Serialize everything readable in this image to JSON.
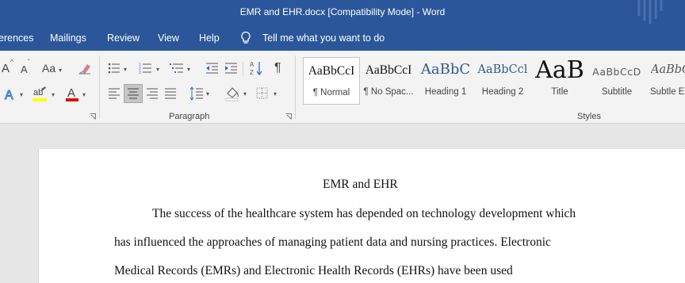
{
  "window": {
    "title": "EMR and EHR.docx [Compatibility Mode]  -  Word"
  },
  "menu": {
    "tabs": [
      "erences",
      "Mailings",
      "Review",
      "View",
      "Help"
    ],
    "tell_me": "Tell me what you want to do"
  },
  "ribbon": {
    "font_size_increase": "A",
    "font_size_decrease": "A",
    "change_case": "Aa",
    "paragraph_label": "Paragraph",
    "styles_label": "Styles",
    "styles": [
      {
        "sample": "AaBbCcI",
        "name": "¶ Normal"
      },
      {
        "sample": "AaBbCcI",
        "name": "¶ No Spac..."
      },
      {
        "sample": "AaBbC",
        "name": "Heading 1"
      },
      {
        "sample": "AaBbCcl",
        "name": "Heading 2"
      },
      {
        "sample": "AaB",
        "name": "Title"
      },
      {
        "sample": "AaBbCcD",
        "name": "Subtitle"
      },
      {
        "sample": "AaBbCcL",
        "name": "Subtle Em"
      }
    ],
    "colors": {
      "highlight": "#ffff00",
      "font_color": "#e00000"
    }
  },
  "document": {
    "title": "EMR and EHR",
    "lines": [
      "The success of the healthcare system has depended on technology development which",
      "has influenced the approaches of managing patient data and nursing practices. Electronic",
      "Medical Records (EMRs) and Electronic Health Records (EHRs) have been used"
    ]
  },
  "theme": {
    "word_blue": "#2b579a"
  }
}
